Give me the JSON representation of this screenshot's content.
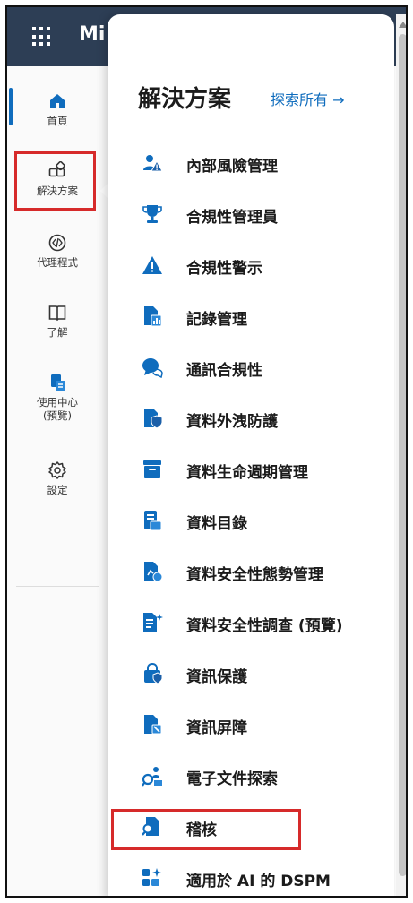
{
  "app": {
    "brand": "Mi"
  },
  "leftnav": {
    "items": [
      {
        "label": "首頁",
        "icon": "home-icon"
      },
      {
        "label": "解決方案",
        "icon": "solutions-icon"
      },
      {
        "label": "代理程式",
        "icon": "code-icon"
      },
      {
        "label": "了解",
        "icon": "book-icon"
      },
      {
        "label": "使用中心",
        "label2": "(預覽)",
        "icon": "usage-center-icon"
      },
      {
        "label": "設定",
        "icon": "gear-icon"
      }
    ]
  },
  "panel": {
    "title": "解決方案",
    "explore_link": "探索所有 →",
    "items": [
      {
        "label": "內部風險管理",
        "icon": "person-warning-icon"
      },
      {
        "label": "合規性管理員",
        "icon": "trophy-icon"
      },
      {
        "label": "合規性警示",
        "icon": "warning-icon"
      },
      {
        "label": "記錄管理",
        "icon": "document-chart-icon"
      },
      {
        "label": "通訊合規性",
        "icon": "chat-bubble-icon"
      },
      {
        "label": "資料外洩防護",
        "icon": "document-shield-icon"
      },
      {
        "label": "資料生命週期管理",
        "icon": "archive-icon"
      },
      {
        "label": "資料目錄",
        "icon": "catalog-icon"
      },
      {
        "label": "資料安全性態勢管理",
        "icon": "document-posture-icon"
      },
      {
        "label": "資料安全性調查 (預覽)",
        "icon": "document-sparkle-icon"
      },
      {
        "label": "資訊保護",
        "icon": "lock-shield-icon"
      },
      {
        "label": "資訊屏障",
        "icon": "document-barrier-icon"
      },
      {
        "label": "電子文件探索",
        "icon": "ediscovery-icon"
      },
      {
        "label": "稽核",
        "icon": "document-search-icon"
      },
      {
        "label": "適用於 AI 的 DSPM",
        "icon": "ai-sparkle-icon"
      }
    ]
  },
  "colors": {
    "accent": "#0f6cbd",
    "topbar": "#2d3e55",
    "highlight": "#d62a2a"
  }
}
